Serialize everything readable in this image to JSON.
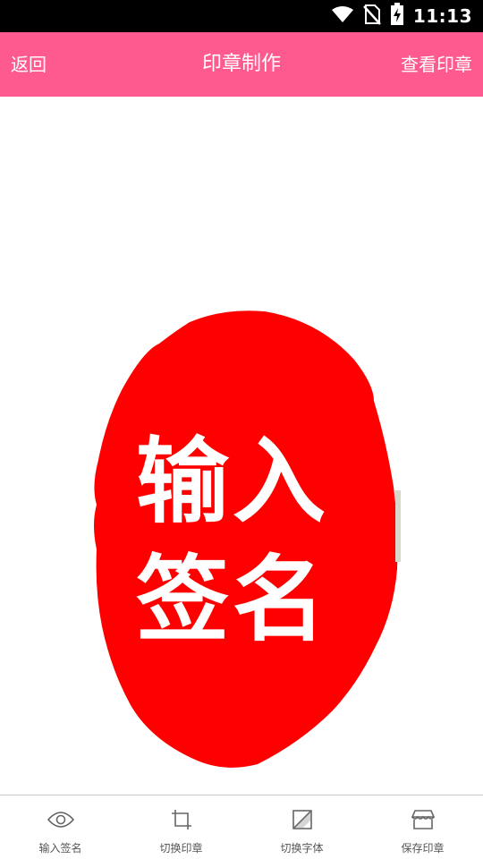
{
  "status_bar": {
    "time": "11:13",
    "icons": [
      "wifi-icon",
      "no-sim-icon",
      "battery-charging-icon"
    ]
  },
  "app_bar": {
    "back_label": "返回",
    "title": "印章制作",
    "view_label": "查看印章",
    "background_color": "#ff5a8f"
  },
  "stamp": {
    "line1": "输入",
    "line2": "签名",
    "color": "#ff0000",
    "text_color": "#ffffff"
  },
  "bottom_nav": {
    "items": [
      {
        "label": "输入签名",
        "icon": "eye-icon"
      },
      {
        "label": "切换印章",
        "icon": "crop-icon"
      },
      {
        "label": "切换字体",
        "icon": "font-switch-icon"
      },
      {
        "label": "保存印章",
        "icon": "store-icon"
      }
    ]
  }
}
